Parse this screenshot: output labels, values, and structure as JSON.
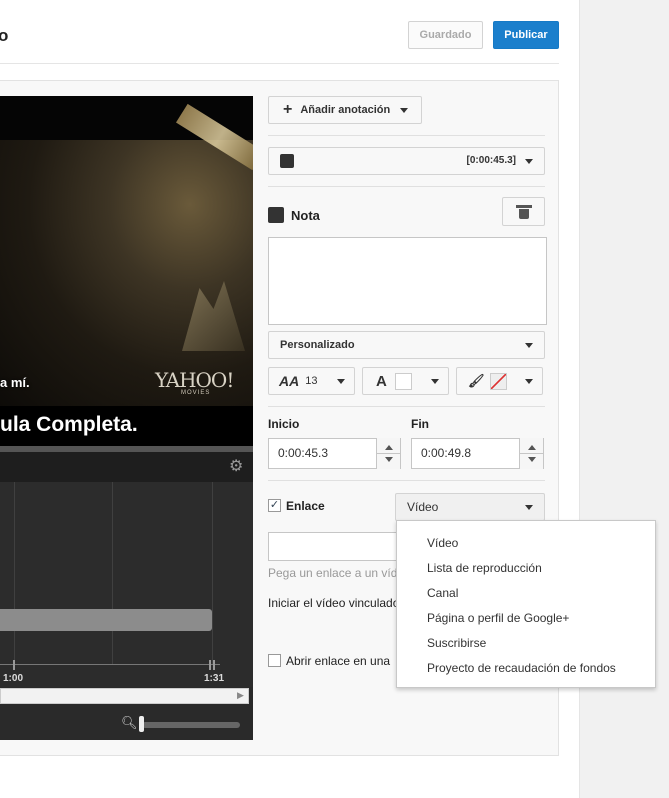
{
  "header": {
    "title_fragment": "o",
    "saved_label": "Guardado",
    "publish_label": "Publicar"
  },
  "video": {
    "subtitle_small": "a mí.",
    "watermark_logo": "YAHOO!",
    "watermark_sub": "MOVIES",
    "caption": "ula Completa."
  },
  "timeline": {
    "tick_labels": [
      "1:00",
      "1:31"
    ]
  },
  "panel": {
    "add_annotation_label": "Añadir anotación",
    "annotation_time": "[0:00:45.3]",
    "note_title": "Nota",
    "style_value": "Personalizado",
    "font_size": "13",
    "start_label": "Inicio",
    "start_value": "0:00:45.3",
    "end_label": "Fin",
    "end_value": "0:00:49.8",
    "link_label": "Enlace",
    "link_checked": true,
    "link_type": "Vídeo",
    "link_hint": "Pega un enlace a un víde",
    "start_video_label": "Iniciar el vídeo vinculado",
    "open_new_label": "Abrir enlace en una"
  },
  "dropdown": {
    "items": [
      "Vídeo",
      "Lista de reproducción",
      "Canal",
      "Página o perfil de Google+",
      "Suscribirse",
      "Proyecto de recaudación de fondos"
    ]
  },
  "colors": {
    "publish_blue": "#1b7fcc",
    "panel_bg": "#f8f8f8",
    "video_black": "#000000"
  },
  "icons": {
    "add": "plus-icon",
    "note": "note-icon",
    "delete": "trash-icon",
    "settings": "gear-icon",
    "zoom": "magnifier-icon",
    "font_size": "font-size-icon",
    "font_color": "font-color-icon",
    "background": "paint-bucket-icon"
  }
}
